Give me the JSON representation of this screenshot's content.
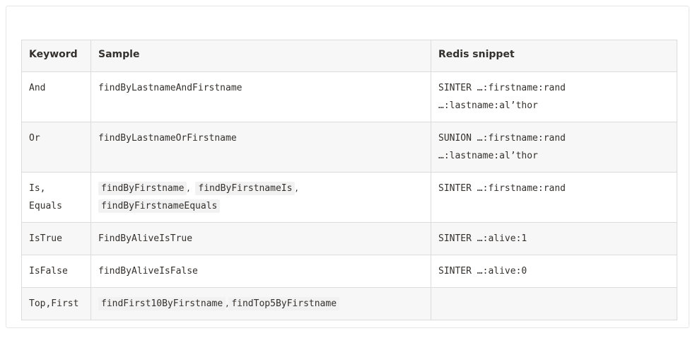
{
  "headers": {
    "keyword": "Keyword",
    "sample": "Sample",
    "redis": "Redis snippet"
  },
  "rows": [
    {
      "keyword": "And",
      "sample": "findByLastnameAndFirstname",
      "redis_line1": "SINTER …:firstname:rand",
      "redis_line2": "…:lastname:al’thor"
    },
    {
      "keyword": "Or",
      "sample": "findByLastnameOrFirstname",
      "redis_line1": "SUNION …:firstname:rand",
      "redis_line2": "…:lastname:al’thor"
    },
    {
      "keyword_line1": "Is,",
      "keyword_line2": "Equals",
      "sample_code1": "findByFirstname",
      "sample_sep1": ",",
      "sample_code2": "findByFirstnameIs",
      "sample_sep2": ",",
      "sample_code3": "findByFirstnameEquals",
      "redis_line1": "SINTER …:firstname:rand"
    },
    {
      "keyword": "IsTrue",
      "sample": "FindByAliveIsTrue",
      "redis_line1": "SINTER …:alive:1"
    },
    {
      "keyword": "IsFalse",
      "sample": "findByAliveIsFalse",
      "redis_line1": "SINTER …:alive:0"
    },
    {
      "keyword": "Top,First",
      "sample_code1": "findFirst10ByFirstname",
      "sample_sep1": ",",
      "sample_code2": "findTop5ByFirstname",
      "redis_line1": ""
    }
  ]
}
